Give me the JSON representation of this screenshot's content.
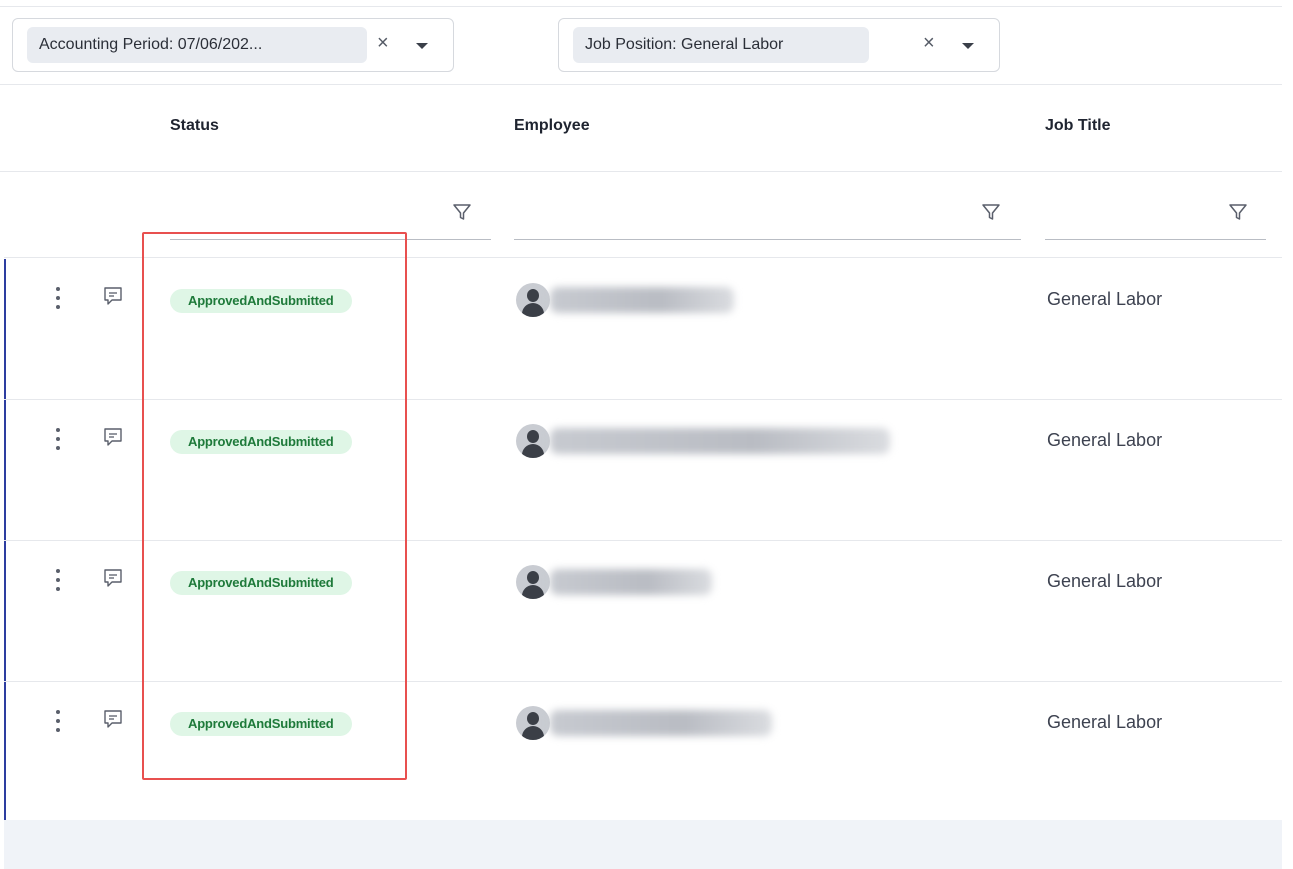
{
  "filters": {
    "accounting_period": {
      "label": "Accounting Period: 07/06/202..."
    },
    "job_position": {
      "label": "Job Position: General Labor"
    },
    "clear_glyph": "×"
  },
  "columns": {
    "status": "Status",
    "employee": "Employee",
    "job_title": "Job Title"
  },
  "rows": [
    {
      "status": "ApprovedAndSubmitted",
      "job_title": "General Labor"
    },
    {
      "status": "ApprovedAndSubmitted",
      "job_title": "General Labor"
    },
    {
      "status": "ApprovedAndSubmitted",
      "job_title": "General Labor"
    },
    {
      "status": "ApprovedAndSubmitted",
      "job_title": "General Labor"
    }
  ],
  "colors": {
    "status_badge_bg": "#dff6e6",
    "status_badge_text": "#1e7a3a",
    "row_accent": "#2d3da0",
    "highlight": "#e8504f"
  },
  "icons": {
    "row_menu": "kebab-icon",
    "row_comment": "comment-icon",
    "column_filter": "funnel-icon",
    "filter_clear": "close-icon",
    "filter_dropdown": "caret-down-icon",
    "employee_photo": "person-icon"
  }
}
